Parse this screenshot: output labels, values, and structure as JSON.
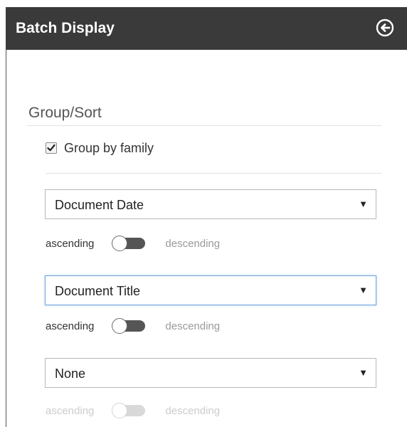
{
  "header": {
    "title": "Batch Display",
    "back_icon": "circle-arrow-left-icon"
  },
  "group_sort": {
    "title": "Group/Sort",
    "group_by_family": {
      "label": "Group by family",
      "checked": true
    },
    "sorts": [
      {
        "value": "Document Date",
        "ascending_label": "ascending",
        "descending_label": "descending",
        "order": "ascending",
        "enabled": true,
        "focused": false
      },
      {
        "value": "Document Title",
        "ascending_label": "ascending",
        "descending_label": "descending",
        "order": "ascending",
        "enabled": true,
        "focused": true
      },
      {
        "value": "None",
        "ascending_label": "ascending",
        "descending_label": "descending",
        "order": "ascending",
        "enabled": false,
        "focused": false
      }
    ]
  },
  "colors": {
    "header_bg": "#3a3a3a",
    "focus_border": "#74a6dd",
    "toggle_track": "#555555"
  }
}
